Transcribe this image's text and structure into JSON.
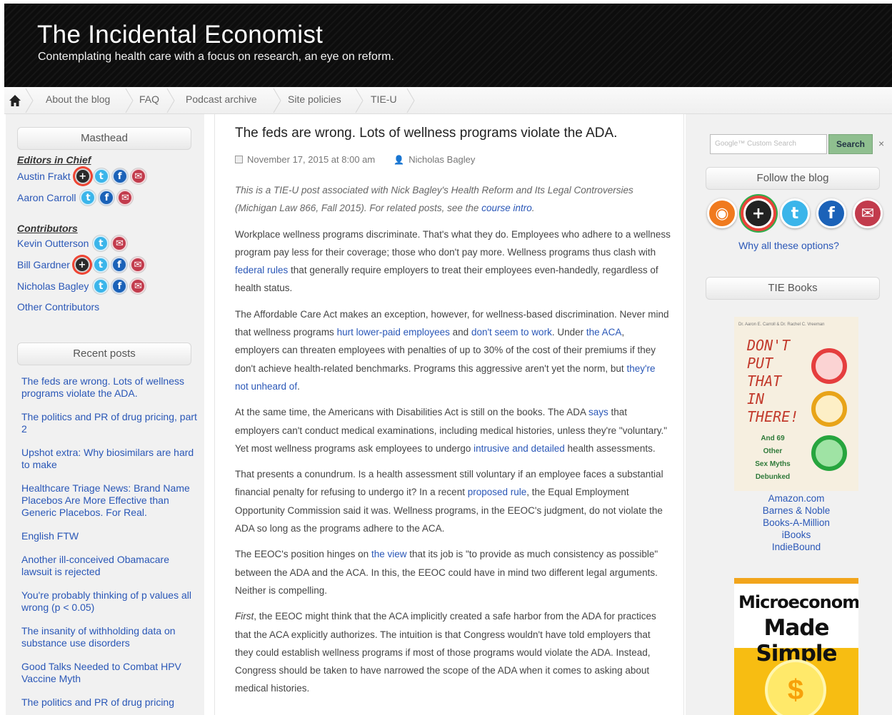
{
  "site": {
    "title": "The Incidental Economist",
    "tagline": "Contemplating health care with a focus on research, an eye on reform."
  },
  "nav": {
    "home_icon": "home-icon",
    "items": [
      "About the blog",
      "FAQ",
      "Podcast archive",
      "Site policies",
      "TIE-U"
    ]
  },
  "left": {
    "masthead_title": "Masthead",
    "editors_heading": "Editors in Chief",
    "contributors_heading": "Contributors",
    "people": [
      {
        "name": "Austin Frakt",
        "icons": [
          "google-plus-icon",
          "twitter-icon",
          "facebook-icon",
          "email-icon"
        ]
      },
      {
        "name": "Aaron Carroll",
        "icons": [
          "twitter-icon",
          "facebook-icon",
          "email-icon"
        ]
      },
      {
        "name": "Kevin Outterson",
        "icons": [
          "twitter-icon",
          "email-icon"
        ]
      },
      {
        "name": "Bill Gardner",
        "icons": [
          "google-plus-icon",
          "twitter-icon",
          "facebook-icon",
          "email-icon"
        ]
      },
      {
        "name": "Nicholas Bagley",
        "icons": [
          "twitter-icon",
          "facebook-icon",
          "email-icon"
        ]
      }
    ],
    "other_contributors": "Other Contributors",
    "recent_title": "Recent posts",
    "recent_posts": [
      "The feds are wrong. Lots of wellness programs violate the ADA.",
      "The politics and PR of drug pricing, part 2",
      "Upshot extra: Why biosimilars are hard to make",
      "Healthcare Triage News: Brand Name Placebos Are More Effective than Generic Placebos. For Real.",
      "English FTW",
      "Another ill-conceived Obamacare lawsuit is rejected",
      "You're probably thinking of p values all wrong (p < 0.05)",
      "The insanity of withholding data on substance use disorders",
      "Good Talks Needed to Combat HPV Vaccine Myth",
      "The politics and PR of drug pricing"
    ]
  },
  "post": {
    "title": "The feds are wrong. Lots of wellness programs violate the ADA.",
    "date": "November 17, 2015 at 8:00 am",
    "author": "Nicholas Bagley",
    "intro": {
      "text": "This is a TIE-U post associated with Nick Bagley's Health Reform and Its Legal Controversies (Michigan Law 866, Fall 2015). For related posts, see the ",
      "link": "course intro",
      "end": "."
    },
    "p1": {
      "a": "Workplace wellness programs discriminate. That's what they do. Employees who adhere to a wellness program pay less for their coverage; those who don't pay more. Wellness programs thus clash with ",
      "link": "federal rules",
      "b": " that generally require employers to treat their employees even-handedly, regardless of health status."
    },
    "p2": {
      "a": "The Affordable Care Act makes an exception, however, for wellness-based discrimination. Never mind that wellness programs ",
      "link1": "hurt lower-paid employees",
      "b": " and ",
      "link2": "don't seem to work",
      "c": ". Under ",
      "link3": "the ACA",
      "d": ", employers can threaten employees with penalties of up to 30% of the cost of their premiums if they don't achieve health-related benchmarks. Programs this aggressive aren't yet the norm, but ",
      "link4": "they're not unheard of",
      "e": "."
    },
    "p3": {
      "a": "At the same time, the Americans with Disabilities Act is still on the books. The ADA ",
      "link1": "says",
      "b": " that employers can't conduct medical examinations, including medical histories, unless they're \"voluntary.\" Yet most wellness programs ask employees to undergo ",
      "link2": "intrusive and detailed",
      "c": " health assessments."
    },
    "p4": {
      "a": "That presents a conundrum. Is a health assessment still voluntary if an employee faces a substantial financial penalty for refusing to undergo it? In a recent ",
      "link": "proposed rule",
      "b": ", the Equal Employment Opportunity Commission said it was. Wellness programs, in the EEOC's judgment, do not violate the ADA so long as the programs adhere to the ACA."
    },
    "p5": {
      "a": "The EEOC's position hinges on ",
      "link": "the view",
      "b": " that its job is \"to provide as much consistency as possible\" between the ADA and the ACA. In this, the EEOC could have in mind two different legal arguments. Neither is compelling."
    },
    "p6": {
      "first": "First",
      "a": ", the EEOC might think that the ACA implicitly created a safe harbor from the ADA for practices that the ACA explicitly authorizes. The intuition is that Congress wouldn't have told employers that they could establish wellness programs if most of those programs would violate the ADA. Instead, Congress should be taken to have narrowed the scope of the ADA when it comes to asking about medical histories."
    }
  },
  "right": {
    "search_placeholder": "Google™ Custom Search",
    "search_button": "Search",
    "search_clear": "×",
    "follow_title": "Follow the blog",
    "follow_icons": [
      "rss-icon",
      "google-plus-icon",
      "twitter-icon",
      "facebook-icon",
      "email-icon"
    ],
    "why_link": "Why all these options?",
    "books_title": "TIE Books",
    "book1": {
      "authors": "Dr. Aaron E. Carroll & Dr. Rachel C. Vreeman",
      "title_lines": [
        "DON'T",
        "PUT",
        "THAT",
        "IN",
        "THERE!"
      ],
      "sub_lines": [
        "And 69",
        "Other",
        "Sex Myths",
        "Debunked"
      ]
    },
    "stores": [
      "Amazon.com",
      "Barnes & Noble",
      "Books-A-Million",
      "iBooks",
      "IndieBound"
    ],
    "book2": {
      "line1": "Microeconomics",
      "line2": "Made Simple"
    },
    "colors": {
      "link": "#2a57b7",
      "search_button": "#8fbf8f",
      "book2_band": "#f7bd12"
    }
  }
}
